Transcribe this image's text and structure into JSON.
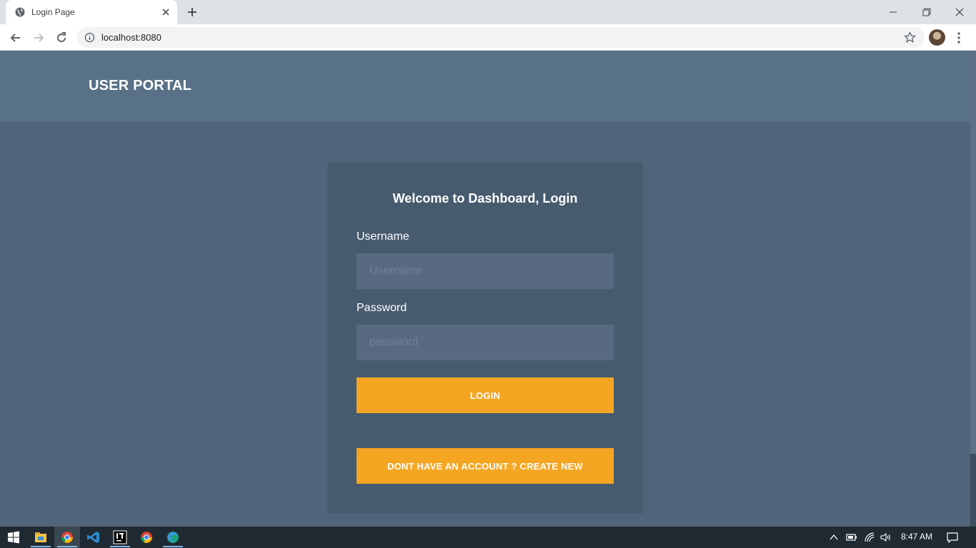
{
  "browser": {
    "tab_title": "Login Page",
    "url": "localhost:8080"
  },
  "header": {
    "brand": "USER PORTAL"
  },
  "login": {
    "title": "Welcome to Dashboard, Login",
    "username_label": "Username",
    "username_placeholder": "Username",
    "username_value": "",
    "password_label": "Password",
    "password_placeholder": "password",
    "password_value": "",
    "login_button": "LOGIN",
    "create_button": "DONT HAVE AN ACCOUNT ? CREATE NEW"
  },
  "colors": {
    "page_bg": "#50647a",
    "header_bg": "#587186",
    "card_bg": "#475b6f",
    "input_bg": "#586a80",
    "accent": "#f4a623"
  },
  "taskbar": {
    "apps": [
      "windows-start",
      "file-explorer",
      "chrome",
      "vscode",
      "intellij",
      "chrome-alt",
      "edge"
    ],
    "time": "8:47 AM"
  }
}
